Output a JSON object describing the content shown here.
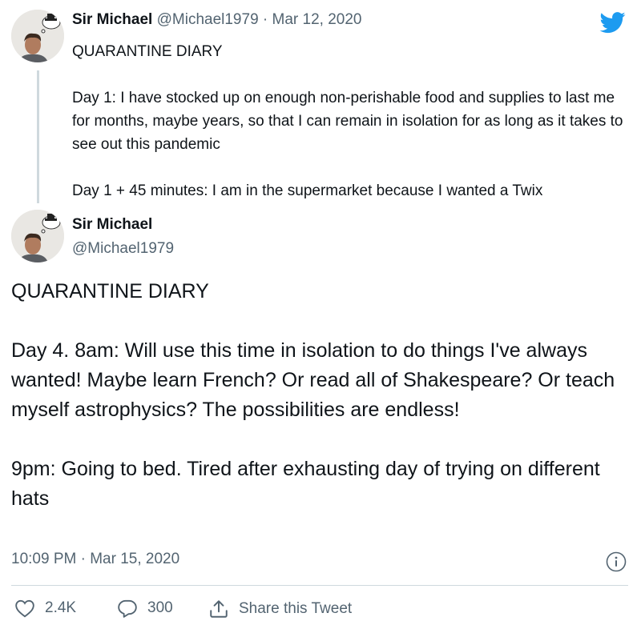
{
  "reply_tweet": {
    "name": "Sir Michael",
    "handle": "@Michael1979",
    "separator": "·",
    "date": "Mar 12, 2020",
    "lines": [
      "QUARANTINE DIARY",
      "",
      "Day 1: I have stocked up on enough non-perishable food and supplies to last me for months, maybe years, so that I can remain in isolation for as long as it takes to see out this pandemic",
      "",
      "Day 1 + 45 minutes: I am in the supermarket because I wanted a Twix"
    ]
  },
  "main_tweet": {
    "name": "Sir Michael",
    "handle": "@Michael1979",
    "paragraphs": [
      "QUARANTINE DIARY",
      "Day 4. 8am: Will use this time in isolation to do things I've always wanted! Maybe learn French? Or read all of Shakespeare? Or teach myself astrophysics? The possibilities are endless!",
      "9pm: Going to bed. Tired after exhausting day of trying on different hats"
    ],
    "timestamp": "10:09 PM · Mar 15, 2020"
  },
  "actions": {
    "likes": "2.4K",
    "replies": "300",
    "share_label": "Share this Tweet"
  },
  "icons": {
    "brand": "twitter-bird-icon",
    "like": "heart-icon",
    "reply": "speech-bubble-icon",
    "share": "share-icon",
    "info": "info-icon"
  },
  "colors": {
    "twitter_blue": "#1d9bf0",
    "muted": "#536471"
  }
}
